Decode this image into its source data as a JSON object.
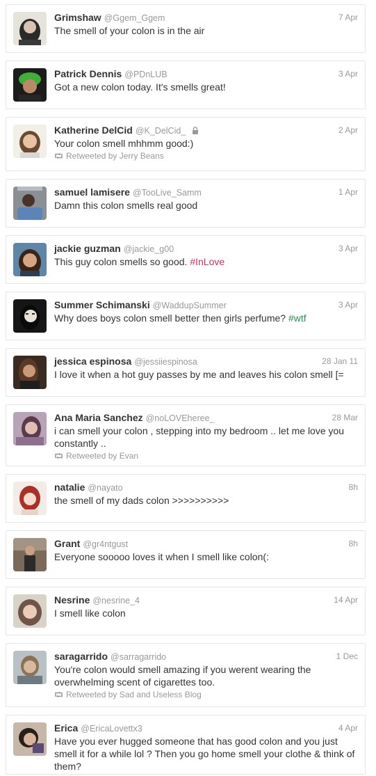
{
  "tweets": [
    {
      "name": "Grimshaw",
      "handle": "@Ggem_Ggem",
      "time": "7 Apr",
      "text": "The smell of your colon is in the air",
      "avatar": "user-avatar"
    },
    {
      "name": "Patrick Dennis",
      "handle": "@PDnLUB",
      "time": "3 Apr",
      "text": "Got a new colon today. It's smells great!",
      "avatar": "user-avatar"
    },
    {
      "name": "Katherine DelCid",
      "handle": "@K_DelCid_",
      "protected": true,
      "time": "2 Apr",
      "text": "Your colon smell mhhmm good:)",
      "retweeted_by": "Retweeted by Jerry Beans",
      "avatar": "user-avatar"
    },
    {
      "name": "samuel lamisere",
      "handle": "@TooLive_Samm",
      "time": "1 Apr",
      "text": "Damn this colon smells real good",
      "avatar": "user-avatar"
    },
    {
      "name": "jackie guzman",
      "handle": "@jackie_g00",
      "time": "3 Apr",
      "text": "This guy colon smells so good. ",
      "hashtag": "#InLove",
      "avatar": "user-avatar"
    },
    {
      "name": "Summer Schimanski",
      "handle": "@WaddupSummer",
      "time": "3 Apr",
      "text": "Why does boys colon smell better then girls perfume? ",
      "hashtag": "#wtf",
      "avatar": "user-avatar"
    },
    {
      "name": "jessica espinosa",
      "handle": "@jessiiespinosa",
      "time": "28 Jan 11",
      "text": "I love it when a hot guy passes by me and leaves his colon smell [=",
      "avatar": "user-avatar"
    },
    {
      "name": "Ana Maria Sanchez",
      "handle": "@noLOVEheree_",
      "time": "28 Mar",
      "text": "i can smell your colon , stepping into my bedroom .. let me love you constantly ..",
      "retweeted_by": "Retweeted by Evan",
      "avatar": "user-avatar"
    },
    {
      "name": "natalie",
      "handle": "@nayato",
      "time": "8h",
      "text": "the smell of my dads colon >>>>>>>>>>",
      "avatar": "user-avatar"
    },
    {
      "name": "Grant",
      "handle": "@gr4ntgust",
      "time": "8h",
      "text": "Everyone sooooo loves it when I smell like colon(:",
      "avatar": "user-avatar"
    },
    {
      "name": "Nesrine",
      "handle": "@nesrine_4",
      "time": "14 Apr",
      "text": "I smell like colon",
      "avatar": "user-avatar"
    },
    {
      "name": "saragarrido",
      "handle": "@sarragarrido",
      "time": "1 Dec",
      "text": "You're colon would smell amazing if you werent wearing the overwhelming scent of cigarettes too.",
      "retweeted_by": "Retweeted by Sad and Useless Blog",
      "avatar": "user-avatar"
    },
    {
      "name": "Erica",
      "handle": "@EricaLovettx3",
      "time": "4 Apr",
      "text": "Have you ever hugged someone that has good colon and you just smell it for a while lol ? Then you go home smell your clothe & think of them?",
      "avatar": "user-avatar"
    }
  ],
  "colors": {
    "name": "#333333",
    "meta": "#999999",
    "border": "#e1e8ed",
    "hashtag_inlove": "#c0365a",
    "hashtag_wtf": "#2e8b57"
  },
  "icons": {
    "protected": "lock-icon",
    "retweet": "retweet-icon"
  }
}
